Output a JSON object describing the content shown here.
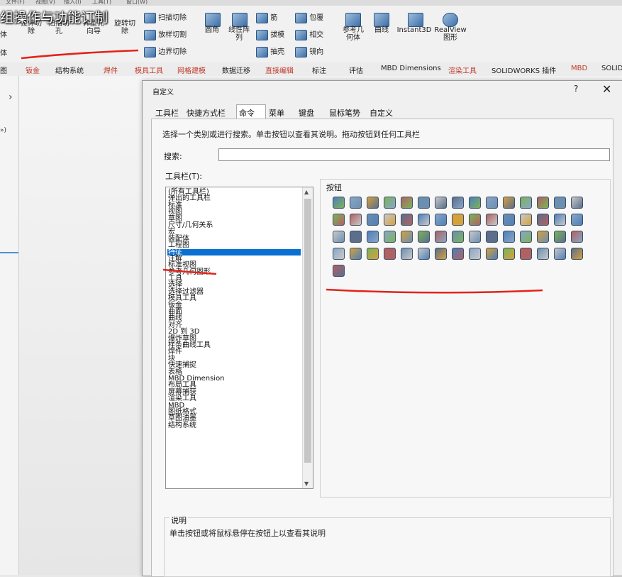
{
  "overlay_title": "组操作与功能订制",
  "menubar": [
    "文件(F)",
    "视图(V)",
    "插入(I)",
    "工具(T)",
    "窗口(W)"
  ],
  "ribbon": {
    "left_labels": [
      "体",
      "体"
    ],
    "vertical_buttons": [
      "拉伸切\n除",
      "异型孔\n向导",
      "旋转切\n除"
    ],
    "vertical_buttons2": [
      "扫描切\n孔"
    ],
    "small_group1": [
      "扫描切除",
      "放样切割",
      "边界切除"
    ],
    "big_buttons": [
      "圆角",
      "线性阵\n列"
    ],
    "small_group2": [
      "筋",
      "拔模",
      "抽壳"
    ],
    "small_group3": [
      "包覆",
      "相交",
      "镜向"
    ],
    "ref_geom": "参考几\n何体",
    "curves": "曲线",
    "instant3d": "Instant3D",
    "realview": "RealView\n图形"
  },
  "command_tabs": [
    {
      "label": "图",
      "red": false
    },
    {
      "label": "钣金",
      "red": true
    },
    {
      "label": "结构系统",
      "red": false
    },
    {
      "label": "焊件",
      "red": true
    },
    {
      "label": "模具工具",
      "red": true
    },
    {
      "label": "网格建模",
      "red": true
    },
    {
      "label": "数据迁移",
      "red": false
    },
    {
      "label": "直接编辑",
      "red": true
    },
    {
      "label": "标注",
      "red": false
    },
    {
      "label": "评估",
      "red": false
    },
    {
      "label": "MBD Dimensions",
      "red": false
    },
    {
      "label": "渲染工具",
      "red": true
    },
    {
      "label": "SOLIDWORKS 插件",
      "red": false
    },
    {
      "label": "MBD",
      "red": true
    },
    {
      "label": "SOLID",
      "red": false
    }
  ],
  "left_panel": {
    "chevron": "›",
    "text": "»)"
  },
  "dialog": {
    "title": "自定义",
    "help": "?",
    "close": "✕",
    "tabs": [
      "工具栏",
      "快捷方式栏",
      "命令",
      "菜单",
      "键盘",
      "鼠标笔势",
      "自定义"
    ],
    "active_tab": "命令",
    "instruction": "选择一个类别或进行搜索。单击按钮以查看其说明。拖动按钮到任何工具栏",
    "search_label": "搜索:",
    "search_value": "",
    "toolbars_label": "工具栏(T):",
    "toolbars": [
      "(所有工具栏)",
      "弹出的工具栏",
      "标准",
      "视图",
      "草图",
      "尺寸/几何关系",
      "宏",
      "装配体",
      "工程图",
      "特征",
      "注解",
      "标准视图",
      "参考几何图形",
      "工具",
      "选择",
      "选择过滤器",
      "模具工具",
      "钣金",
      "曲面",
      "曲线",
      "对齐",
      "2D 到 3D",
      "爆炸草图",
      "样条曲线工具",
      "焊件",
      "块",
      "快速捕捉",
      "表格",
      "MBD Dimension",
      "布局工具",
      "屏幕捕获",
      "渲染工具",
      "MBD",
      "图纸格式",
      "草图油墨",
      "结构系统"
    ],
    "selected_toolbar": "特征",
    "buttons_label": "按钮",
    "desc_label": "说明",
    "desc_text": "单击按钮或将鼠标悬停在按钮上以查看其说明"
  },
  "colors": {
    "accent": "#0a6fd1",
    "annotation_red": "#e3231b"
  }
}
